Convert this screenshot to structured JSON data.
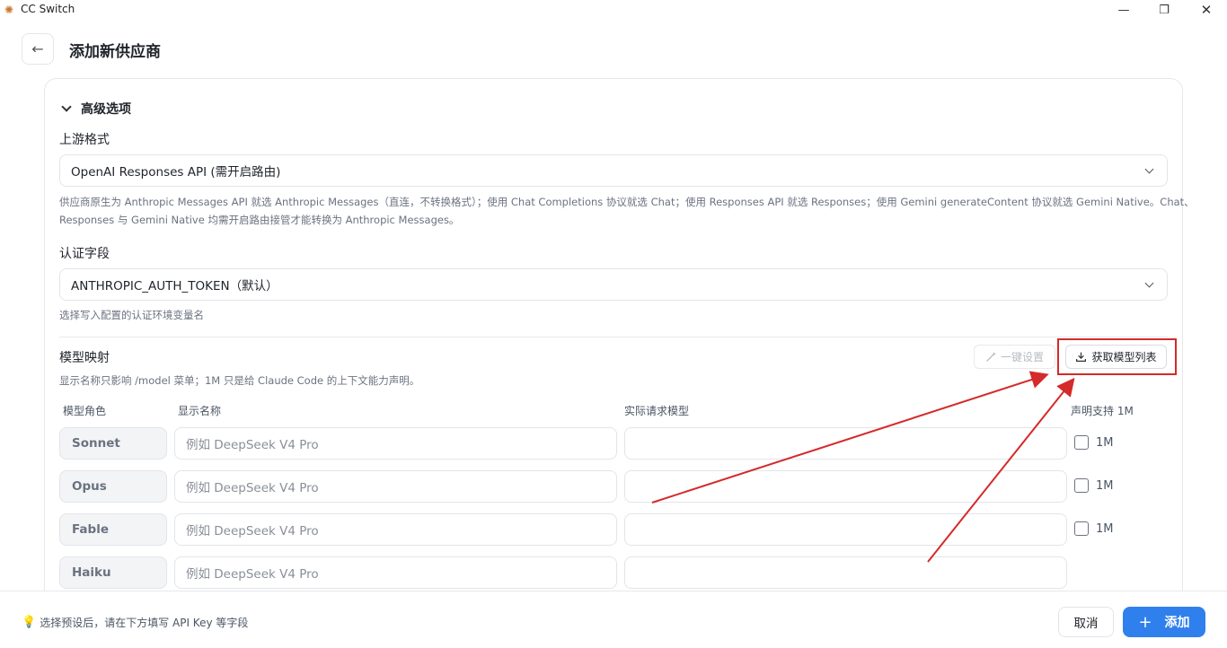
{
  "window": {
    "title": "CC Switch",
    "minimize": "—",
    "maximize": "❐",
    "close": "✕"
  },
  "header": {
    "back_icon": "←",
    "title": "添加新供应商"
  },
  "advanced": {
    "toggle_label": "高级选项",
    "upstream_format": {
      "label": "上游格式",
      "value": "OpenAI Responses API (需开启路由)",
      "hint_line1": "供应商原生为 Anthropic Messages API 就选 Anthropic Messages（直连，不转换格式）；使用 Chat Completions 协议就选 Chat；使用 Responses API 就选 Responses；使用 Gemini generateContent 协议就选 Gemini Native。Chat、",
      "hint_line2": "Responses 与 Gemini Native 均需开启路由接管才能转换为 Anthropic Messages。"
    },
    "auth_field": {
      "label": "认证字段",
      "value": "ANTHROPIC_AUTH_TOKEN（默认）",
      "hint": "选择写入配置的认证环境变量名"
    }
  },
  "model_mapping": {
    "title": "模型映射",
    "hint": "显示名称只影响 /model 菜单；1M 只是给 Claude Code 的上下文能力声明。",
    "one_click_label": "一键设置",
    "fetch_label": "获取模型列表",
    "columns": {
      "role": "模型角色",
      "display": "显示名称",
      "actual": "实际请求模型",
      "support": "声明支持 1M"
    },
    "rows": [
      {
        "role": "Sonnet",
        "display_placeholder": "例如 DeepSeek V4 Pro",
        "actual": "",
        "checkbox_label": "1M"
      },
      {
        "role": "Opus",
        "display_placeholder": "例如 DeepSeek V4 Pro",
        "actual": "",
        "checkbox_label": "1M"
      },
      {
        "role": "Fable",
        "display_placeholder": "例如 DeepSeek V4 Pro",
        "actual": "",
        "checkbox_label": "1M"
      },
      {
        "role": "Haiku",
        "display_placeholder": "例如 DeepSeek V4 Pro",
        "actual": ""
      }
    ]
  },
  "footer": {
    "hint": "选择预设后，请在下方填写 API Key 等字段",
    "cancel_label": "取消",
    "add_label": "添加"
  },
  "colors": {
    "accent": "#2f80ed",
    "annotation": "#d42a2a"
  }
}
